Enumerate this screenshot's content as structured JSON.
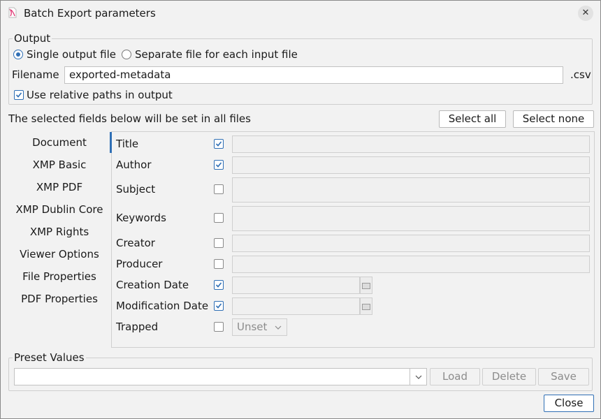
{
  "window": {
    "title": "Batch Export parameters"
  },
  "output": {
    "legend": "Output",
    "single_label": "Single output file",
    "separate_label": "Separate file for each input file",
    "filename_label": "Filename",
    "filename_value": "exported-metadata",
    "extension": ".csv",
    "relative_paths_label": "Use relative paths in output",
    "relative_paths_checked": true,
    "mode": "single"
  },
  "fields_header": {
    "text": "The selected fields below will be set in all files",
    "select_all": "Select all",
    "select_none": "Select none"
  },
  "nav": {
    "items": [
      "Document",
      "XMP Basic",
      "XMP PDF",
      "XMP Dublin Core",
      "XMP Rights",
      "Viewer Options",
      "File Properties",
      "PDF Properties"
    ],
    "selected": "Document"
  },
  "fields": [
    {
      "label": "Title",
      "checked": true
    },
    {
      "label": "Author",
      "checked": true
    },
    {
      "label": "Subject",
      "checked": false
    },
    {
      "label": "Keywords",
      "checked": false
    },
    {
      "label": "Creator",
      "checked": false
    },
    {
      "label": "Producer",
      "checked": false
    },
    {
      "label": "Creation Date",
      "checked": true
    },
    {
      "label": "Modification Date",
      "checked": true
    },
    {
      "label": "Trapped",
      "checked": false
    }
  ],
  "trapped": {
    "value": "Unset"
  },
  "presets": {
    "legend": "Preset Values",
    "value": "",
    "load": "Load",
    "delete": "Delete",
    "save": "Save"
  },
  "footer": {
    "close": "Close"
  },
  "colors": {
    "accent": "#2f6fb5"
  }
}
